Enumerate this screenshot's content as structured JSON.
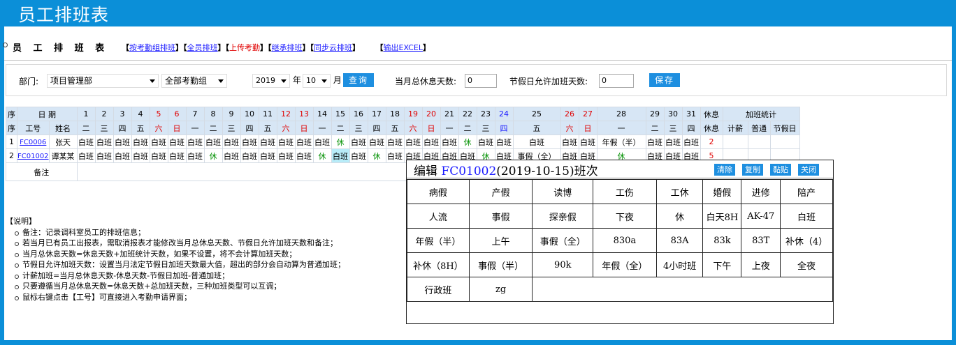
{
  "app_title": "员工排班表",
  "page": {
    "title": "员 工 排 班 表",
    "links": [
      {
        "label": "按考勤组排班"
      },
      {
        "label": "全员排班"
      },
      {
        "label": "上传考勤",
        "plain": true
      },
      {
        "label": "继承排班"
      },
      {
        "label": "同步云排班"
      },
      {
        "label": "输出EXCEL"
      }
    ]
  },
  "filter": {
    "dept_label": "部门:",
    "dept_value": "项目管理部",
    "group_value": "全部考勤组",
    "year_value": "2019",
    "year_suffix": "年",
    "month_value": "10",
    "month_suffix": "月",
    "query_label": "查询",
    "rest_label": "当月总休息天数:",
    "rest_value": "0",
    "ot_label": "节假日允许加班天数:",
    "ot_value": "0",
    "save_label": "保存"
  },
  "grid": {
    "h1": {
      "seq": "序",
      "date": "日 期",
      "rest": "休息",
      "ot": "加班统计"
    },
    "h2": {
      "seq": "序",
      "emp_no": "工号",
      "name": "姓名",
      "rest": "休息",
      "ot_calc": "计薪",
      "ot_normal": "普通",
      "ot_holiday": "节假日"
    },
    "days": [
      "1",
      "2",
      "3",
      "4",
      "5",
      "6",
      "7",
      "8",
      "9",
      "10",
      "11",
      "12",
      "13",
      "14",
      "15",
      "16",
      "17",
      "18",
      "19",
      "20",
      "21",
      "22",
      "23",
      "24",
      "25",
      "26",
      "27",
      "28",
      "29",
      "30",
      "31"
    ],
    "weekdays": [
      "二",
      "三",
      "四",
      "五",
      "六",
      "日",
      "一",
      "二",
      "三",
      "四",
      "五",
      "六",
      "日",
      "一",
      "二",
      "三",
      "四",
      "五",
      "六",
      "日",
      "一",
      "二",
      "三",
      "四",
      "五",
      "六",
      "日",
      "一",
      "二",
      "三",
      "四"
    ],
    "red_days": [
      5,
      6,
      12,
      13,
      19,
      20,
      26,
      27
    ],
    "blue_days": [
      24
    ],
    "rows": [
      {
        "seq": "1",
        "emp_no": "FC0006",
        "name": "张天",
        "shifts": [
          "白班",
          "白班",
          "白班",
          "白班",
          "白班",
          "白班",
          "白班",
          "白班",
          "白班",
          "白班",
          "白班",
          "白班",
          "白班",
          "白班",
          "休",
          "白班",
          "白班",
          "白班",
          "白班",
          "白班",
          "白班",
          "休",
          "白班",
          "白班",
          "白班",
          "白班",
          "白班",
          "年假（半）",
          "白班",
          "白班",
          "白班"
        ],
        "rest": "2"
      },
      {
        "seq": "2",
        "emp_no": "FC01002",
        "name": "谭某某",
        "shifts": [
          "白班",
          "白班",
          "白班",
          "白班",
          "白班",
          "白班",
          "白班",
          "休",
          "白班",
          "白班",
          "白班",
          "白班",
          "白班",
          "休",
          "白班",
          "白班",
          "休",
          "白班",
          "白班",
          "白班",
          "白班",
          "白班",
          "休",
          "白班",
          "事假（全）",
          "白班",
          "白班",
          "休",
          "白班",
          "白班",
          "白班"
        ],
        "rest": "5"
      }
    ],
    "remark_label": "备注"
  },
  "notes": {
    "heading": "【说明】",
    "items": [
      "备注：记录调科室员工的排班信息；",
      "若当月已有员工出报表，需取消报表才能修改当月总休息天数、节假日允许加班天数和备注；",
      "当月总休息天数=休息天数+加班统计天数，如果不设置，将不会计算加班天数；",
      "节假日允许加班天数：设置当月法定节假日加班天数最大值，超出的部分会自动算为普通加班；",
      "计薪加班=当月总休息天数-休息天数-节假日加班-普通加班；",
      "只要遵循当月总休息天数=休息天数+总加班天数，三种加班类型可以互调；",
      "鼠标右键点击【工号】可直接进入考勤申请界面；"
    ]
  },
  "popup": {
    "edit_label": "编辑",
    "emp_no": "FC01002",
    "date_text": "(2019-10-15)班次",
    "buttons": [
      "清除",
      "复制",
      "黏贴",
      "关闭"
    ],
    "rows": [
      [
        "病假",
        "产假",
        "读博",
        "工伤",
        "工休",
        "婚假",
        "进修",
        "陪产"
      ],
      [
        "人流",
        "事假",
        "探亲假",
        "下夜",
        "休",
        "白天8H",
        "AK-47",
        "白班"
      ],
      [
        "年假（半）",
        "上午",
        "事假（全）",
        "830a",
        "83A",
        "83k",
        "83T",
        "补休（4）"
      ],
      [
        "补休（8H）",
        "事假（半）",
        "90k",
        "年假（全）",
        "4小时班",
        "下午",
        "上夜",
        "全夜"
      ],
      [
        "行政班",
        "zg"
      ]
    ]
  }
}
